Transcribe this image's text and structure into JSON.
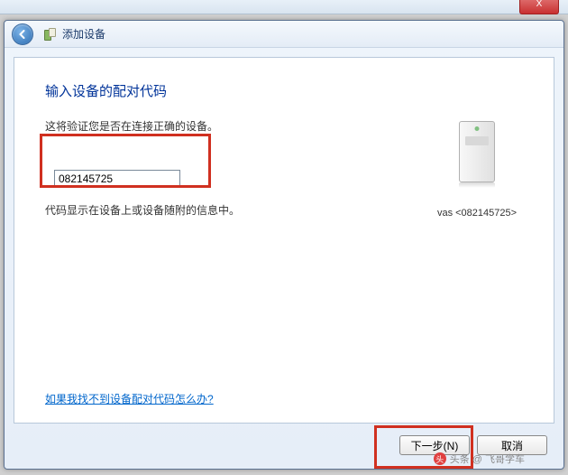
{
  "bg_window": {
    "close": "X"
  },
  "header": {
    "title": "添加设备"
  },
  "main": {
    "heading": "输入设备的配对代码",
    "subtext": "这将验证您是否在连接正确的设备。",
    "code_value": "082145725",
    "hint": "代码显示在设备上或设备随附的信息中。"
  },
  "device": {
    "label": "vas <082145725>"
  },
  "link": {
    "help": "如果我找不到设备配对代码怎么办?"
  },
  "buttons": {
    "next": "下一步(N)",
    "cancel": "取消"
  },
  "watermark": {
    "text": "头条 @ 飞哥学车",
    "logo": "头"
  }
}
